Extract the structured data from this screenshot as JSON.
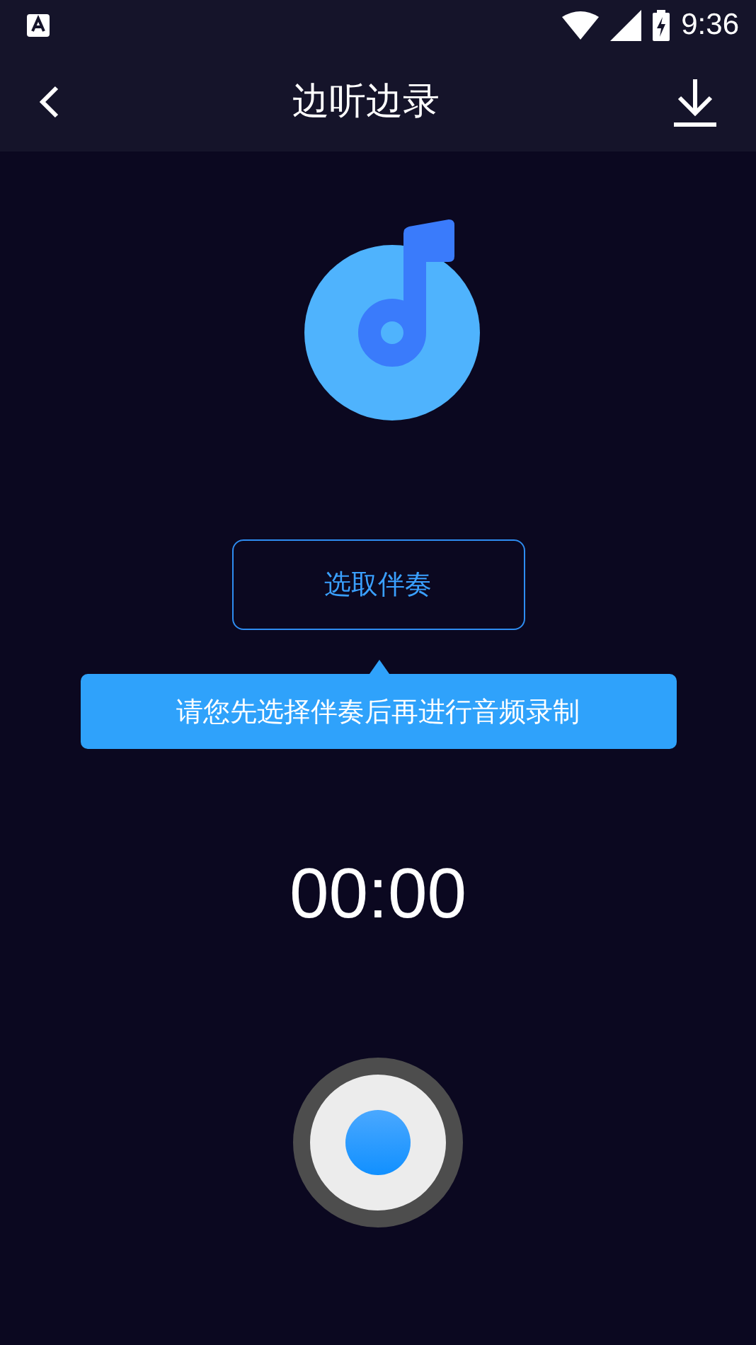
{
  "status_bar": {
    "time": "9:36"
  },
  "header": {
    "title": "边听边录"
  },
  "select_button": {
    "label": "选取伴奏"
  },
  "tooltip": {
    "text": "请您先选择伴奏后再进行音频录制"
  },
  "timer": {
    "text": "00:00"
  }
}
